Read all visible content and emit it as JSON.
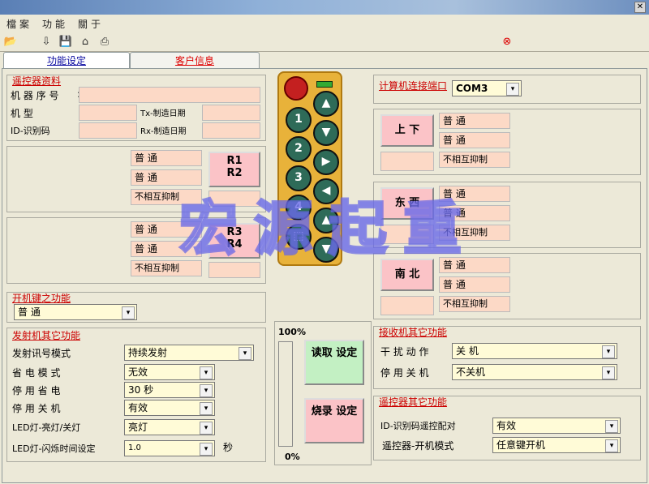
{
  "menu": [
    "檔案",
    "功能",
    "關于"
  ],
  "tabs": {
    "functions": "功能设定",
    "customer": "客户信息"
  },
  "remote_info": {
    "title": "遥控器资料",
    "serial_label": "机 器 序 号",
    "model_label": "机      型",
    "id_label": "ID-识别码",
    "tx_date_label": "Tx-制造日期",
    "rx_date_label": "Rx-制造日期"
  },
  "r_group_1": {
    "row1": "普      通",
    "row2": "普      通",
    "row3": "不相互抑制",
    "btn_top": "R1",
    "btn_bottom": "R2"
  },
  "r_group_2": {
    "row1": "普      通",
    "row2": "普      通",
    "row3": "不相互抑制",
    "btn_top": "R3",
    "btn_bottom": "R4"
  },
  "power_key": {
    "title": "开机键之功能",
    "value": "普      通"
  },
  "tx_other": {
    "title": "发射机其它功能",
    "rows": [
      {
        "label": "发射讯号模式",
        "value": "持续发射"
      },
      {
        "label": "省 电 模 式",
        "value": "无效"
      },
      {
        "label": "停 用 省 电",
        "value": "30 秒"
      },
      {
        "label": "停 用 关 机",
        "value": "有效"
      },
      {
        "label": "LED灯-亮灯/关灯",
        "value": "亮灯"
      },
      {
        "label": "LED灯-闪烁时间设定",
        "value": "1.0"
      }
    ],
    "unit_seconds": "秒"
  },
  "progress": {
    "top_label": "100%",
    "bottom_label": "0%",
    "value": 0
  },
  "actions": {
    "read": "读取 设定",
    "burn": "烧录 设定"
  },
  "port": {
    "label": "计算机连接端口",
    "value": "COM3"
  },
  "directions": [
    {
      "btn": "上  下",
      "row1": "普      通",
      "row2": "普      通",
      "row3": "不相互抑制"
    },
    {
      "btn": "东  西",
      "row1": "普      通",
      "row2": "普      通",
      "row3": "不相互抑制"
    },
    {
      "btn": "南  北",
      "row1": "普      通",
      "row2": "普      通",
      "row3": "不相互抑制"
    }
  ],
  "rx_other": {
    "title": "接收机其它功能",
    "rows": [
      {
        "label": "干 扰 动 作",
        "value": "关   机"
      },
      {
        "label": "停 用 关 机",
        "value": "不关机"
      }
    ]
  },
  "remote_other": {
    "title": "遥控器其它功能",
    "rows": [
      {
        "label": "ID-识别码遥控配对",
        "value": "有效"
      },
      {
        "label": "遥控器-开机模式",
        "value": "任意键开机"
      }
    ]
  },
  "remote_keys": [
    "1",
    "2",
    "3",
    "4"
  ],
  "watermark": "宏源起重",
  "colors": {
    "field": "#fcd9c6",
    "combo": "#fffbd7",
    "button_pink": "#fbc3c7",
    "button_green": "#c3f0c3",
    "title_red": "#cc0000"
  }
}
